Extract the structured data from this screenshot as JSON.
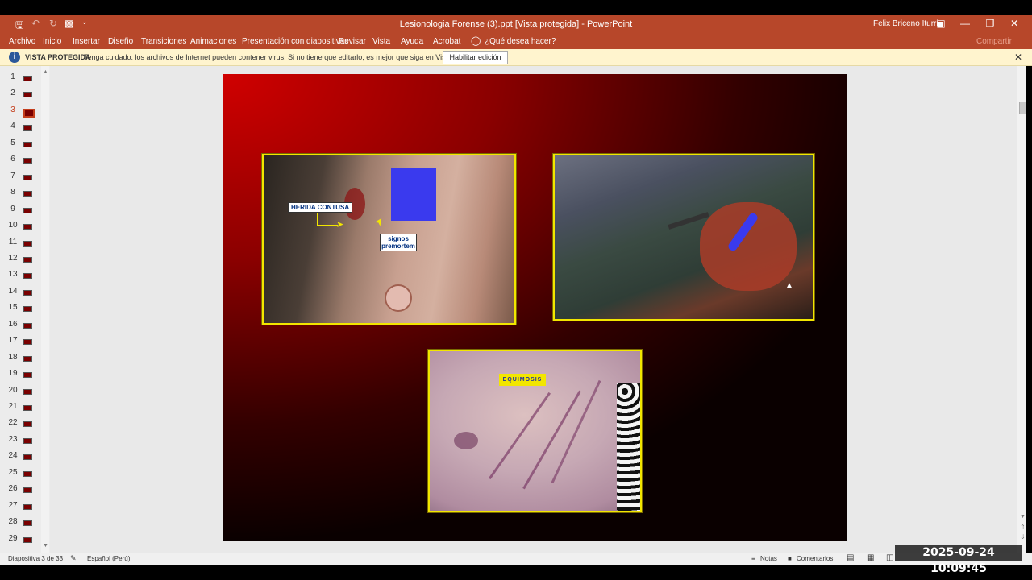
{
  "titlebar": {
    "title": "Lesionologia Forense (3).ppt [Vista protegida] - PowerPoint",
    "user": "Felix Briceno Iturri",
    "icons": [
      "save-icon",
      "undo-icon",
      "redo-icon",
      "present-icon",
      "customize-icon"
    ],
    "window_controls": [
      "ribbon-display-icon",
      "minimize-icon",
      "restore-icon",
      "close-icon"
    ]
  },
  "menu": {
    "items": [
      "Archivo",
      "Inicio",
      "Insertar",
      "Diseño",
      "Transiciones",
      "Animaciones",
      "Presentación con diapositivas",
      "Revisar",
      "Vista",
      "Ayuda",
      "Acrobat"
    ],
    "tell_me": "¿Qué desea hacer?",
    "share": "Compartir"
  },
  "protected": {
    "label": "VISTA PROTEGIDA",
    "message": "Tenga cuidado: los archivos de Internet pueden contener virus. Si no tiene que editarlo, es mejor que siga en Vista protegida.",
    "button": "Habilitar edición"
  },
  "slides": {
    "numbers": [
      "1",
      "2",
      "3",
      "4",
      "5",
      "6",
      "7",
      "8",
      "9",
      "10",
      "11",
      "12",
      "13",
      "14",
      "15",
      "16",
      "17",
      "18",
      "19",
      "20",
      "21",
      "22",
      "23",
      "24",
      "25",
      "26",
      "27",
      "28",
      "29"
    ],
    "current": 3
  },
  "slide": {
    "label_herida": "HERIDA CONTUSA",
    "label_signos": "signos premortem",
    "label_equimosis": "EQUIMOSIS",
    "colors": {
      "frame": "#f2e600",
      "redaction": "#3a3aee"
    }
  },
  "status": {
    "slide_info": "Diapositiva 3 de 33",
    "language": "Español (Perú)",
    "notes": "Notas",
    "comments": "Comentarios"
  },
  "timestamp": "2025-09-24 10:09:45"
}
